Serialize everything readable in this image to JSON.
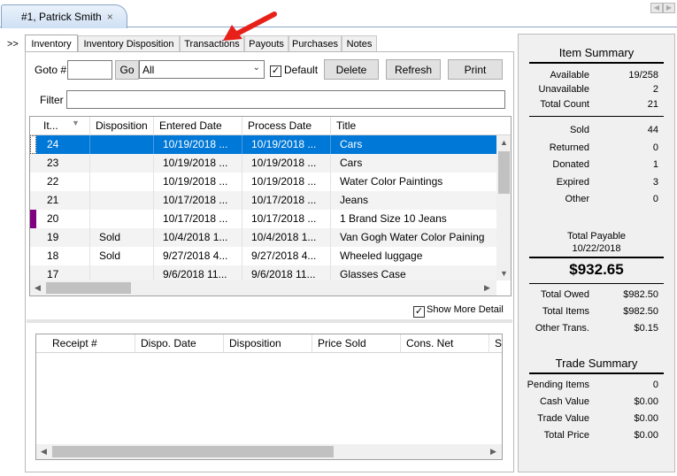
{
  "doc_tab": {
    "title": "#1, Patrick Smith",
    "close": "×"
  },
  "nav": {
    "prev": "◀",
    "next": "▶"
  },
  "collapse_label": ">>",
  "tabs": [
    "Inventory",
    "Inventory Disposition",
    "Transactions",
    "Payouts",
    "Purchases",
    "Notes"
  ],
  "toolbar": {
    "goto_label": "Goto #",
    "goto_value": "",
    "go_label": "Go",
    "filter_select_value": "All",
    "default_label": "Default",
    "default_checked": "✓",
    "delete_label": "Delete",
    "refresh_label": "Refresh",
    "print_label": "Print",
    "filter_label": "Filter",
    "filter_value": ""
  },
  "grid": {
    "columns": [
      "It...",
      "Disposition",
      "Entered Date",
      "Process Date",
      "Title"
    ],
    "rows": [
      {
        "item": "24",
        "disposition": "",
        "entered": "10/19/2018 ...",
        "process": "10/19/2018 ...",
        "title": "Cars"
      },
      {
        "item": "23",
        "disposition": "",
        "entered": "10/19/2018 ...",
        "process": "10/19/2018 ...",
        "title": "Cars"
      },
      {
        "item": "22",
        "disposition": "",
        "entered": "10/19/2018 ...",
        "process": "10/19/2018 ...",
        "title": "Water Color Paintings"
      },
      {
        "item": "21",
        "disposition": "",
        "entered": "10/17/2018 ...",
        "process": "10/17/2018 ...",
        "title": "Jeans"
      },
      {
        "item": "20",
        "disposition": "",
        "entered": "10/17/2018 ...",
        "process": "10/17/2018 ...",
        "title": "1 Brand Size 10 Jeans"
      },
      {
        "item": "19",
        "disposition": "Sold",
        "entered": "10/4/2018 1...",
        "process": "10/4/2018 1...",
        "title": "Van Gogh Water Color Paining"
      },
      {
        "item": "18",
        "disposition": "Sold",
        "entered": "9/27/2018 4...",
        "process": "9/27/2018 4...",
        "title": "Wheeled luggage"
      },
      {
        "item": "17",
        "disposition": "",
        "entered": "9/6/2018 11...",
        "process": "9/6/2018 11...",
        "title": "Glasses Case"
      }
    ],
    "row20_marker_color": "#800080",
    "selected_color": "#0078d7"
  },
  "show_more_detail_label": "Show More Detail",
  "show_more_detail_checked": "✓",
  "grid2": {
    "columns": [
      "Receipt #",
      "Dispo. Date",
      "Disposition",
      "Price Sold",
      "Cons. Net",
      "S"
    ]
  },
  "summary": {
    "item_title": "Item Summary",
    "counts": [
      {
        "k": "Available",
        "v": "19/258"
      },
      {
        "k": "Unavailable",
        "v": "2"
      },
      {
        "k": "Total Count",
        "v": "21"
      }
    ],
    "dispositions": [
      {
        "k": "Sold",
        "v": "44"
      },
      {
        "k": "Returned",
        "v": "0"
      },
      {
        "k": "Donated",
        "v": "1"
      },
      {
        "k": "Expired",
        "v": "3"
      },
      {
        "k": "Other",
        "v": "0"
      }
    ],
    "payable_label": "Total Payable",
    "payable_date": "10/22/2018",
    "payable_amount": "$932.65",
    "totals": [
      {
        "k": "Total Owed",
        "v": "$982.50"
      },
      {
        "k": "Total Items",
        "v": "$982.50"
      },
      {
        "k": "Other Trans.",
        "v": "$0.15"
      }
    ],
    "trade_title": "Trade Summary",
    "trade": [
      {
        "k": "Pending Items",
        "v": "0"
      },
      {
        "k": "Cash Value",
        "v": "$0.00"
      },
      {
        "k": "Trade Value",
        "v": "$0.00"
      },
      {
        "k": "Total Price",
        "v": "$0.00"
      }
    ]
  },
  "annotation_arrow_color": "#e8201a"
}
